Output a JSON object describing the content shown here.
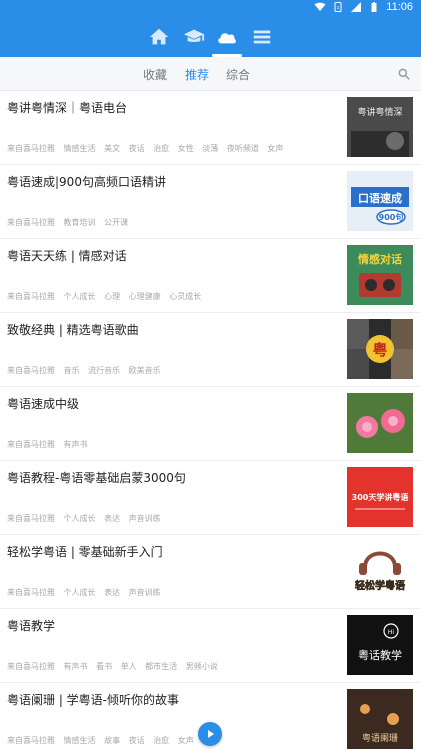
{
  "status_bar": {
    "time": "11:06",
    "icons": [
      "wifi-icon",
      "sim-icon",
      "signal-icon",
      "battery-icon"
    ]
  },
  "top_nav": {
    "icons": [
      "home-icon",
      "graduation-cap-icon",
      "cloud-icon",
      "list-icon"
    ],
    "active": "cloud-icon"
  },
  "sub_tabs": {
    "items": [
      "收藏",
      "推荐",
      "综合"
    ],
    "active": "推荐"
  },
  "list": [
    {
      "title": "粤讲粤情深｜粤语电台",
      "source": "来自喜马拉雅",
      "tags": [
        "情感生活",
        "美文",
        "夜话",
        "治愈",
        "女性",
        "淡薄",
        "夜听频道",
        "女声"
      ],
      "thumb_text": "粤讲粤情深"
    },
    {
      "title": "粤语速成|900句高频口语精讲",
      "source": "来自喜马拉雅",
      "tags": [
        "教育培训",
        "公开课"
      ],
      "thumb_text": "口语速成"
    },
    {
      "title": "粤语天天练 | 情感对话",
      "source": "来自喜马拉雅",
      "tags": [
        "个人成长",
        "心理",
        "心理健康",
        "心灵成长"
      ],
      "thumb_text": "情感对话"
    },
    {
      "title": "致敬经典 | 精选粤语歌曲",
      "source": "来自喜马拉雅",
      "tags": [
        "音乐",
        "流行音乐",
        "欧美音乐"
      ],
      "thumb_text": "粤"
    },
    {
      "title": "粤语速成中级",
      "source": "来自喜马拉雅",
      "tags": [
        "有声书"
      ],
      "thumb_text": ""
    },
    {
      "title": "粤语教程-粤语零基础启蒙3000句",
      "source": "来自喜马拉雅",
      "tags": [
        "个人成长",
        "表达",
        "声音训练"
      ],
      "thumb_text": "300天学讲粤语"
    },
    {
      "title": "轻松学粤语 | 零基础新手入门",
      "source": "来自喜马拉雅",
      "tags": [
        "个人成长",
        "表达",
        "声音训练"
      ],
      "thumb_text": "轻松学粤语"
    },
    {
      "title": "粤语教学",
      "source": "来自喜马拉雅",
      "tags": [
        "有声书",
        "看书",
        "单人",
        "都市生活",
        "男频小说"
      ],
      "thumb_text": "粤话教学"
    },
    {
      "title": "粤语阑珊 | 学粤语-倾听你的故事",
      "source": "来自喜马拉雅",
      "tags": [
        "情感生活",
        "故事",
        "夜话",
        "治愈",
        "女声"
      ],
      "thumb_text": "粤语阑珊"
    }
  ],
  "colors": {
    "primary": "#2a8de8",
    "title_text": "#222222",
    "meta_text": "#a8a8a8"
  }
}
